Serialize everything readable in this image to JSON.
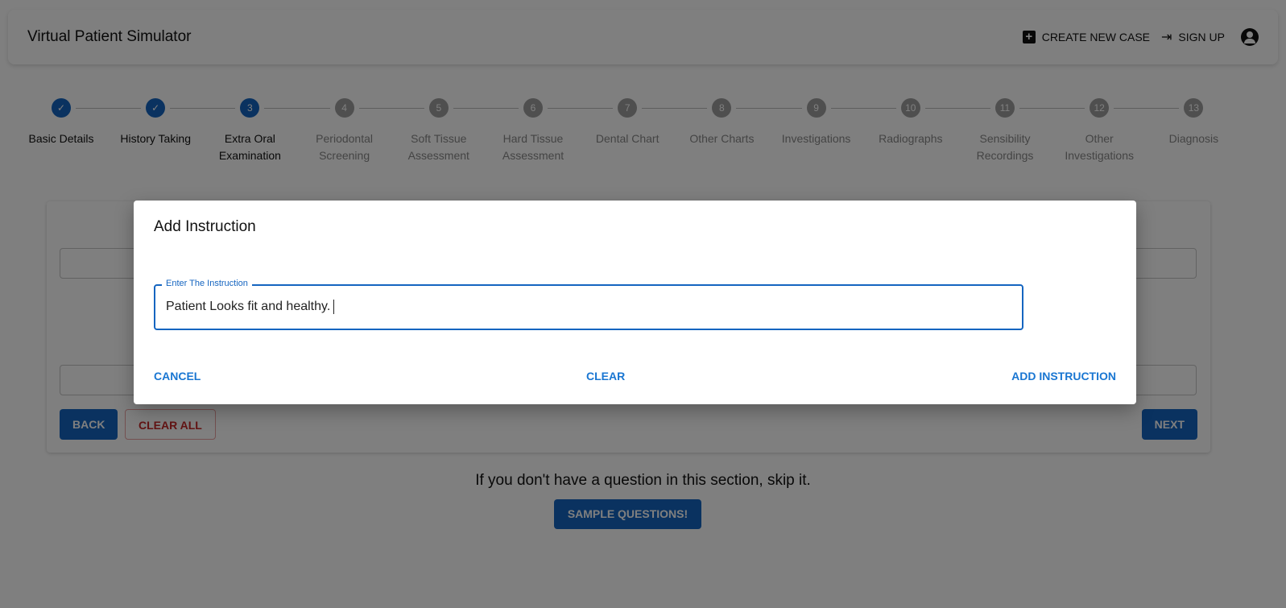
{
  "header": {
    "title": "Virtual Patient Simulator",
    "create_case": "Create New Case",
    "sign_up": "Sign Up"
  },
  "stepper": {
    "steps": [
      {
        "num": "1",
        "label": "Basic Details",
        "state": "done"
      },
      {
        "num": "2",
        "label": "History Taking",
        "state": "done"
      },
      {
        "num": "3",
        "label": "Extra Oral Examination",
        "state": "active"
      },
      {
        "num": "4",
        "label": "Periodontal Screening",
        "state": "pending"
      },
      {
        "num": "5",
        "label": "Soft Tissue Assessment",
        "state": "pending"
      },
      {
        "num": "6",
        "label": "Hard Tissue Assessment",
        "state": "pending"
      },
      {
        "num": "7",
        "label": "Dental Chart",
        "state": "pending"
      },
      {
        "num": "8",
        "label": "Other Charts",
        "state": "pending"
      },
      {
        "num": "9",
        "label": "Investigations",
        "state": "pending"
      },
      {
        "num": "10",
        "label": "Radiographs",
        "state": "pending"
      },
      {
        "num": "11",
        "label": "Sensibility Recordings",
        "state": "pending"
      },
      {
        "num": "12",
        "label": "Other Investigations",
        "state": "pending"
      },
      {
        "num": "13",
        "label": "Diagnosis",
        "state": "pending"
      }
    ]
  },
  "card": {
    "back": "Back",
    "clear_all": "Clear All",
    "next": "Next"
  },
  "skip_text": "If you don't have a question in this section, skip it.",
  "sample_questions": "Sample Questions!",
  "modal": {
    "title": "Add Instruction",
    "field_label": "Enter The Instruction",
    "field_value": "Patient Looks fit and healthy.",
    "cancel": "Cancel",
    "clear": "Clear",
    "add": "Add Instruction"
  },
  "colors": {
    "primary": "#1565c0",
    "danger": "#c62828"
  }
}
